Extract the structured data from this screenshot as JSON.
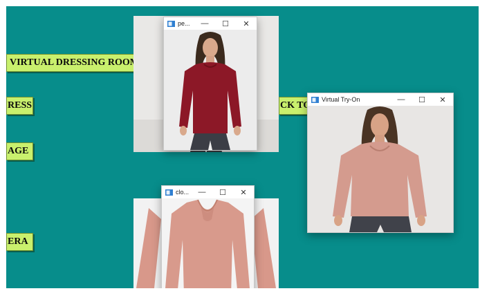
{
  "app": {
    "buttons": {
      "virtual_dressing_room": "VIRTUAL DRESSING ROOM",
      "dress": "RESS",
      "image": "AGE",
      "back_to": "CK TO",
      "camera": "ERA"
    },
    "background_color": "#078d8b",
    "button_color": "#c9f06d"
  },
  "windows": {
    "person": {
      "title": "pe...",
      "minimize_icon": "minimize-icon",
      "maximize_icon": "maximize-icon",
      "close_icon": "close-icon",
      "content": "model-red-top-photo"
    },
    "cloth": {
      "title": "clo...",
      "minimize_icon": "minimize-icon",
      "maximize_icon": "maximize-icon",
      "close_icon": "close-icon",
      "content": "pink-sweater-photo"
    },
    "tryon": {
      "title": "Virtual Try-On",
      "minimize_icon": "minimize-icon",
      "maximize_icon": "maximize-icon",
      "close_icon": "close-icon",
      "content": "tryon-result-photo"
    }
  },
  "glyphs": {
    "minimize": "—",
    "maximize": "☐",
    "close": "✕"
  }
}
